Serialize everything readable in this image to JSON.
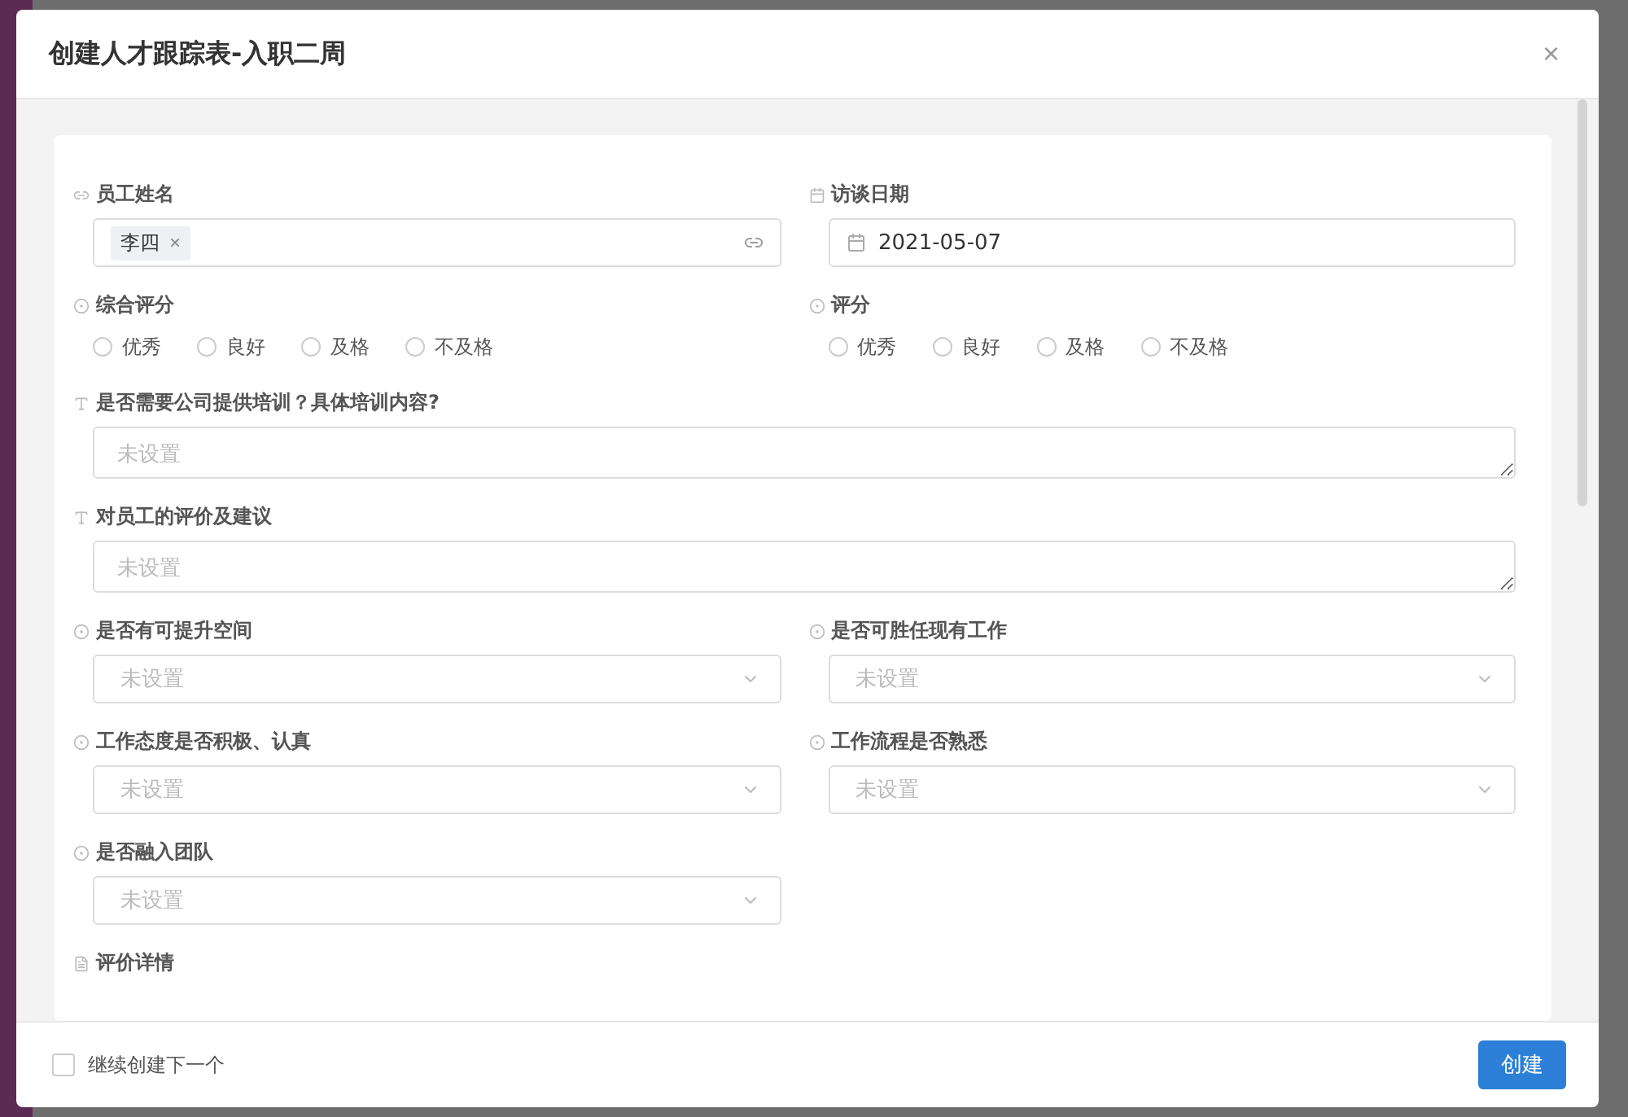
{
  "dialog": {
    "title": "创建人才跟踪表-入职二周",
    "close": "×"
  },
  "fields": [
    {
      "kind": "tags",
      "label": "员工姓名",
      "tags": [
        {
          "text": "李四",
          "remove": "×"
        }
      ]
    },
    {
      "kind": "date",
      "label": "访谈日期",
      "value": "2021-05-07"
    },
    {
      "kind": "radio",
      "label": "综合评分",
      "options": [
        {
          "label": "优秀",
          "selected": false
        },
        {
          "label": "良好",
          "selected": false
        },
        {
          "label": "及格",
          "selected": false
        },
        {
          "label": "不及格",
          "selected": false
        }
      ]
    },
    {
      "kind": "radio",
      "label": "评分",
      "options": [
        {
          "label": "优秀",
          "selected": false
        },
        {
          "label": "良好",
          "selected": false
        },
        {
          "label": "及格",
          "selected": false
        },
        {
          "label": "不及格",
          "selected": false
        }
      ]
    },
    {
      "kind": "textarea",
      "label": "是否需要公司提供培训？具体培训内容?",
      "placeholder": "未设置"
    },
    {
      "kind": "textarea",
      "label": "对员工的评价及建议",
      "placeholder": "未设置"
    },
    {
      "kind": "select",
      "label": "是否有可提升空间",
      "placeholder": "未设置"
    },
    {
      "kind": "select",
      "label": "是否可胜任现有工作",
      "placeholder": "未设置"
    },
    {
      "kind": "select",
      "label": "工作态度是否积极、认真",
      "placeholder": "未设置"
    },
    {
      "kind": "select",
      "label": "工作流程是否熟悉",
      "placeholder": "未设置"
    },
    {
      "kind": "select",
      "label": "是否融入团队",
      "placeholder": "未设置"
    },
    {
      "kind": "section",
      "label": "评价详情"
    }
  ],
  "footer": {
    "continue": {
      "label": "继续创建下一个",
      "checked": false
    },
    "submit": "创建"
  }
}
